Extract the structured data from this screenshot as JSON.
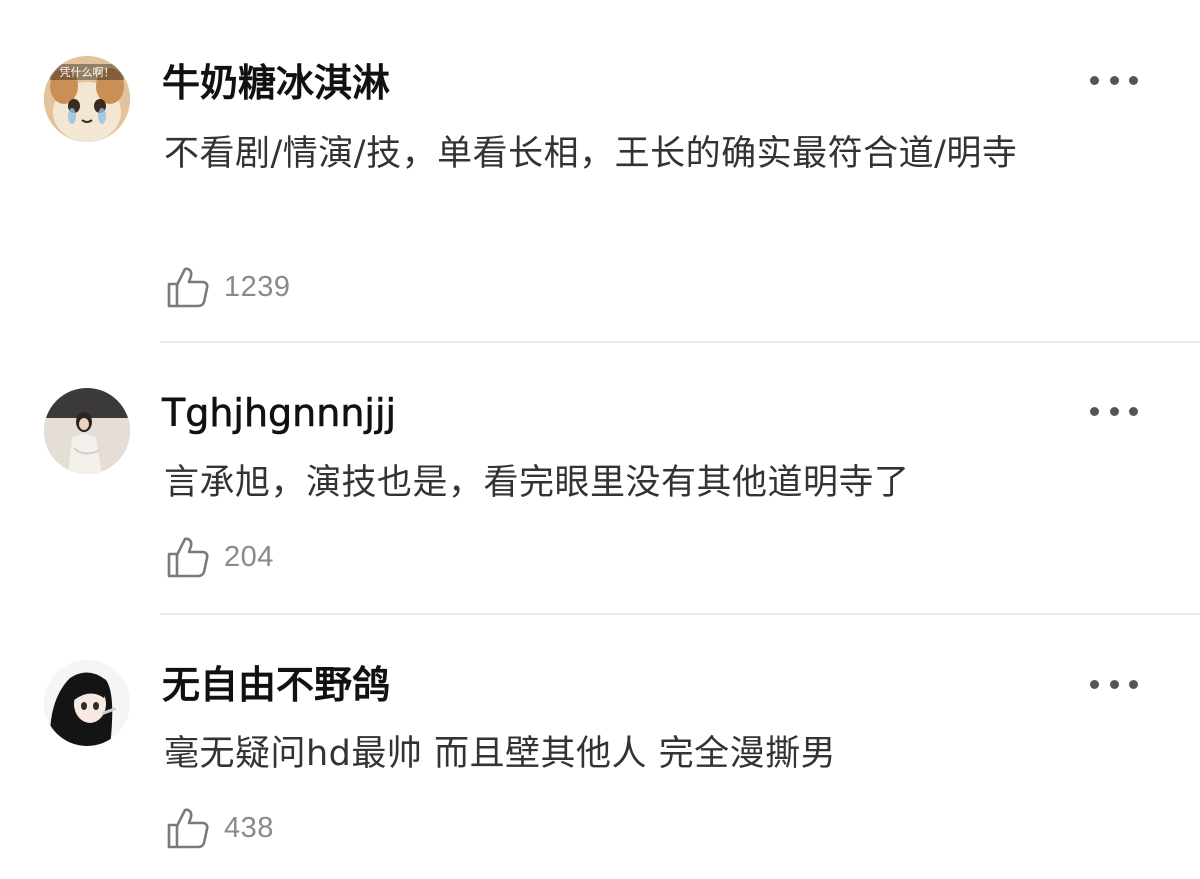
{
  "comments": [
    {
      "username": "牛奶糖冰淇淋",
      "avatar_badge": "凭什么啊！",
      "text": "不看剧/情演/技，单看长相，王长的确实最符合道/明寺",
      "likes": "1239"
    },
    {
      "username": "Tghjhgnnnjjj",
      "text": "言承旭，演技也是，看完眼里没有其他道明寺了",
      "likes": "204"
    },
    {
      "username": "无自由不野鸽",
      "text": "毫无疑问hd最帅 而且壁其他人 完全漫撕男",
      "likes": "438"
    }
  ],
  "icons": {
    "like": "thumbs-up-icon",
    "more": "more-dots-icon"
  },
  "colors": {
    "username": "#111111",
    "body_text": "#333333",
    "like_count": "#8a8a8a",
    "divider": "#e8e8e8"
  }
}
